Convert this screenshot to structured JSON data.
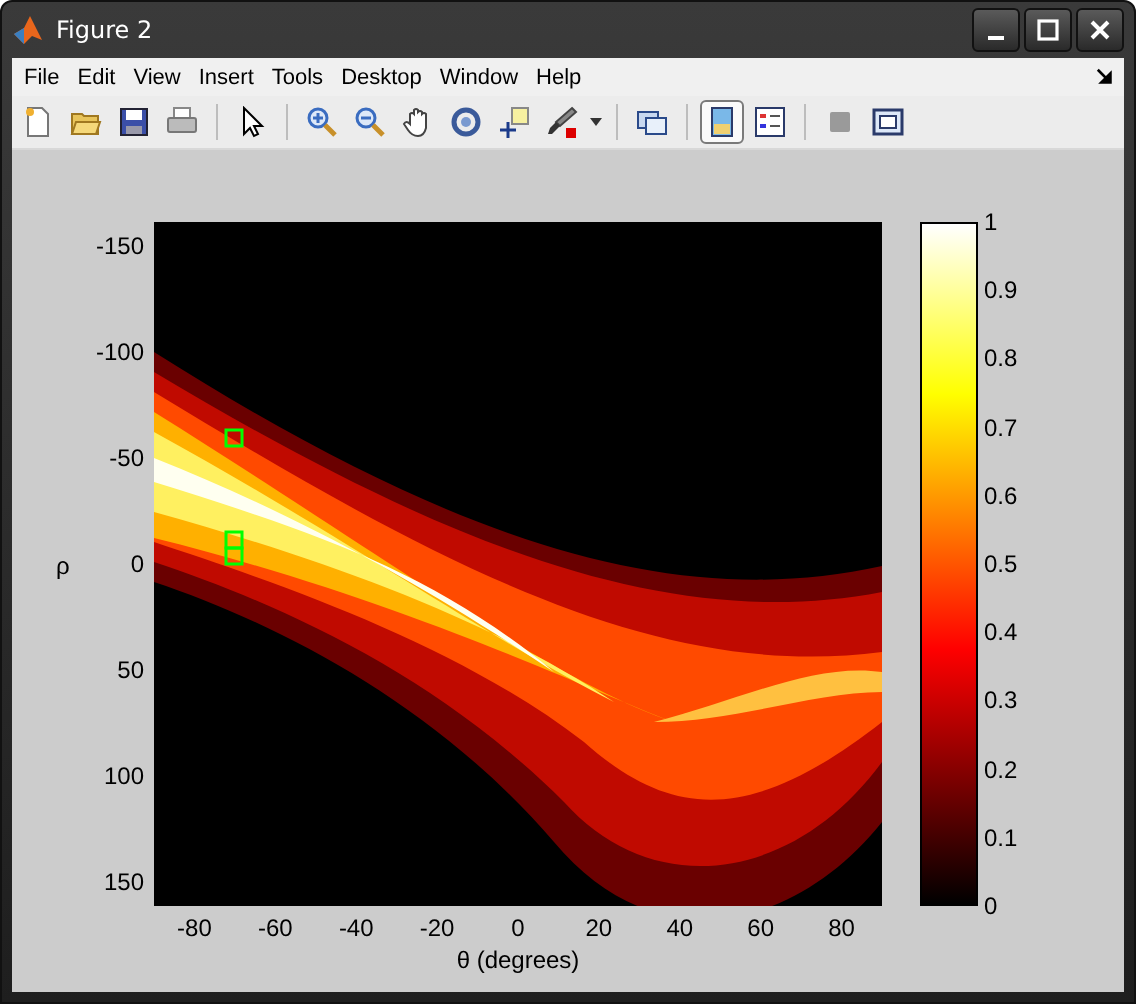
{
  "window": {
    "title": "Figure 2"
  },
  "menu": [
    "File",
    "Edit",
    "View",
    "Insert",
    "Tools",
    "Desktop",
    "Window",
    "Help"
  ],
  "toolbar": [
    {
      "kind": "new",
      "selected": false
    },
    {
      "kind": "open",
      "selected": false
    },
    {
      "kind": "save",
      "selected": false
    },
    {
      "kind": "print",
      "selected": false
    },
    {
      "kind": "sep"
    },
    {
      "kind": "pointer",
      "selected": false
    },
    {
      "kind": "sep"
    },
    {
      "kind": "zoomin",
      "selected": false
    },
    {
      "kind": "zoomout",
      "selected": false
    },
    {
      "kind": "pan",
      "selected": false
    },
    {
      "kind": "rotate",
      "selected": false
    },
    {
      "kind": "cursor",
      "selected": false
    },
    {
      "kind": "brush",
      "selected": false
    },
    {
      "kind": "caret",
      "selected": false
    },
    {
      "kind": "sep"
    },
    {
      "kind": "link",
      "selected": false
    },
    {
      "kind": "sep"
    },
    {
      "kind": "colorbar",
      "selected": true
    },
    {
      "kind": "legend",
      "selected": false
    },
    {
      "kind": "sep"
    },
    {
      "kind": "hide",
      "selected": false
    },
    {
      "kind": "dock",
      "selected": false
    }
  ],
  "plot": {
    "image": {
      "kind": "picture"
    },
    "ylabel": "ρ",
    "xlabel": "θ (degrees)",
    "yticks": [
      "-150",
      "-100",
      "-50",
      "0",
      "50",
      "100",
      "150"
    ],
    "xticks": [
      "-80",
      "-60",
      "-40",
      "-20",
      "0",
      "20",
      "40",
      "60",
      "80"
    ],
    "colorbar": {
      "ticks": [
        "1",
        "0.9",
        "0.8",
        "0.7",
        "0.6",
        "0.5",
        "0.4",
        "0.3",
        "0.2",
        "0.1",
        "0"
      ]
    }
  }
}
